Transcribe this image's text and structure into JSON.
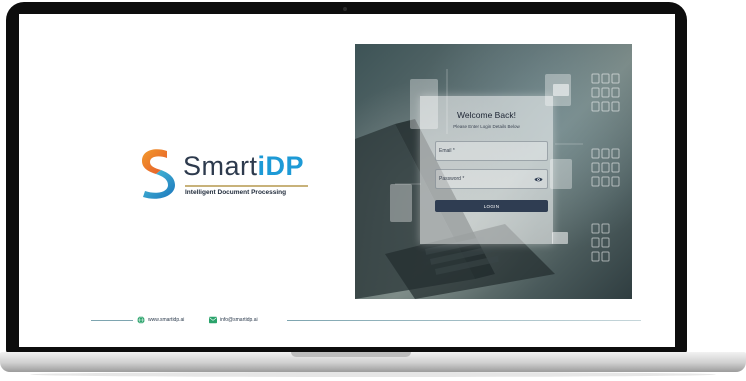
{
  "brand": {
    "name_part1": "Smart",
    "name_part2": "iDP",
    "tagline": "Intelligent Document Processing"
  },
  "login": {
    "title": "Welcome Back!",
    "subtitle": "Please Enter Login Details Below",
    "email_placeholder": "Email *",
    "password_placeholder": "Password *",
    "button_label": "LOGIN"
  },
  "footer": {
    "website": "www.smartidp.ai",
    "email": "info@smartidp.ai"
  },
  "colors": {
    "accent": "#1d9ad6",
    "button": "#2f3d52",
    "brand_text": "#2d3a4d"
  },
  "icons": {
    "logo": "smartidp-s-logo",
    "password_toggle": "eye-icon",
    "website": "globe-icon",
    "email": "mail-icon"
  }
}
